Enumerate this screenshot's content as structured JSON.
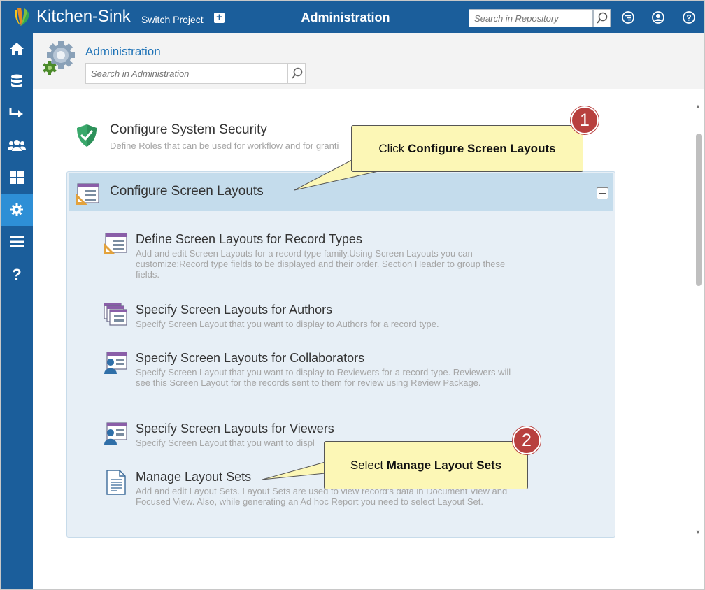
{
  "topbar": {
    "app_title": "Kitchen-Sink",
    "switch_project": "Switch Project",
    "center_title": "Administration",
    "search_placeholder": "Search in Repository"
  },
  "header": {
    "title": "Administration",
    "search_placeholder": "Search in Administration"
  },
  "sidebar": {
    "items": [
      {
        "icon": "home-icon"
      },
      {
        "icon": "database-icon"
      },
      {
        "icon": "arrow-right-icon"
      },
      {
        "icon": "users-icon"
      },
      {
        "icon": "dashboard-icon"
      },
      {
        "icon": "gear-icon",
        "active": true
      },
      {
        "icon": "menu-icon"
      },
      {
        "icon": "help-icon"
      }
    ]
  },
  "security": {
    "title": "Configure System Security",
    "desc": "Define Roles that can be used for workflow and for granti"
  },
  "layouts": {
    "title": "Configure Screen Layouts",
    "items": [
      {
        "title": "Define Screen Layouts for Record Types",
        "desc": "Add and edit Screen Layouts for a record type family.Using Screen Layouts you can customize:Record type fields to be displayed and their order. Section Header to group these fields."
      },
      {
        "title": "Specify Screen Layouts for Authors",
        "desc": "Specify Screen Layout that you want to display to Authors for a record type."
      },
      {
        "title": "Specify Screen Layouts for Collaborators",
        "desc": "Specify Screen Layout that you want to display to Reviewers for a record type. Reviewers will see this Screen Layout for the records sent to them for review using Review Package."
      },
      {
        "title": "Specify Screen Layouts for Viewers",
        "desc": "Specify Screen Layout that you want to displ"
      },
      {
        "title": "Manage Layout Sets",
        "desc": "Add and edit Layout Sets. Layout Sets are used to view record's data in Document View and Focused View. Also, while generating an Ad hoc Report you need to select Layout Set."
      }
    ]
  },
  "callouts": [
    {
      "number": "1",
      "prefix": "Click ",
      "bold": "Configure Screen Layouts"
    },
    {
      "number": "2",
      "prefix": "Select ",
      "bold": "Manage Layout Sets"
    }
  ],
  "colors": {
    "brand": "#1b5e9b",
    "active": "#2e8fd6",
    "link": "#1f73b7",
    "badge": "#b8403e",
    "callout": "#fcf7b6"
  }
}
